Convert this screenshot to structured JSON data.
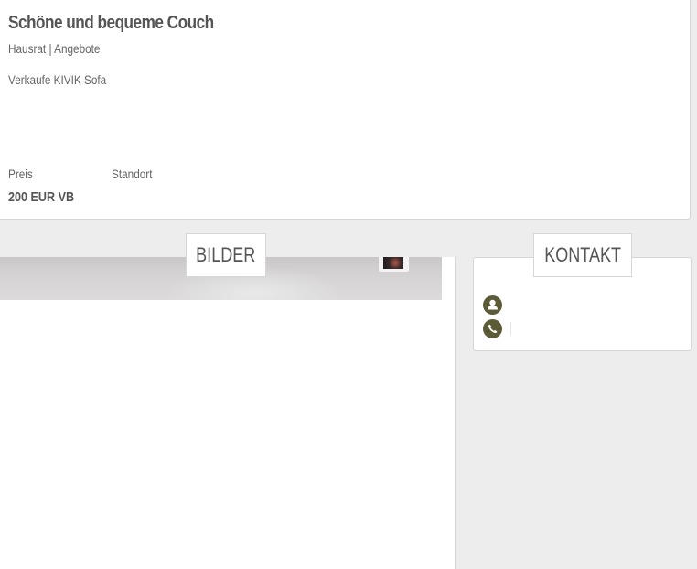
{
  "listing": {
    "title": "Schöne und bequeme Couch",
    "category": "Hausrat | Angebote",
    "description": "Verkaufe KIVIK Sofa",
    "price_label": "Preis",
    "location_label": "Standort",
    "price_value": "200 EUR VB"
  },
  "sections": {
    "images_title": "BILDER",
    "contact_title": "KONTAKT"
  },
  "contact": {
    "person_icon": "user-icon",
    "phone_icon": "phone-icon",
    "accent_color": "#5d5a37"
  },
  "colors": {
    "background": "#ededed",
    "card": "#ffffff",
    "border": "#d6d6d6",
    "text": "#555555"
  }
}
